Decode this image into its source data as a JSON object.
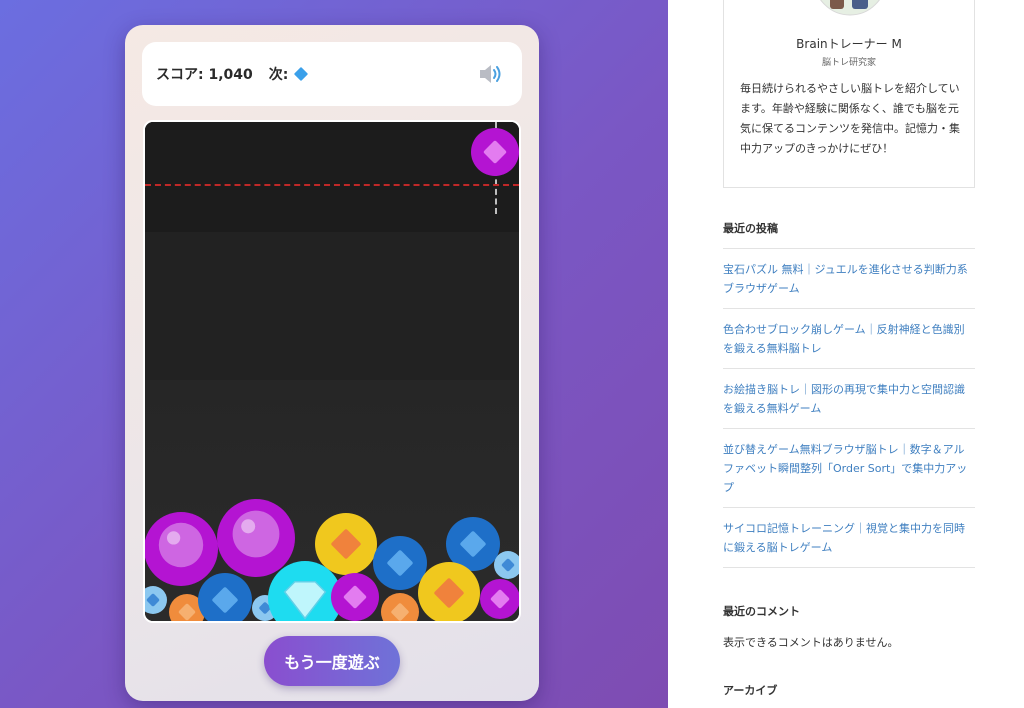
{
  "game": {
    "score_label": "スコア: 1,040",
    "next_label": "次:",
    "replay_label": "もう一度遊ぶ",
    "colors": {
      "purple": "#b414d2",
      "blue": "#1e6fc8",
      "yellow": "#f0c81e",
      "cyan": "#1edcf0",
      "orange": "#f08c3c",
      "lightblue": "#8cc8f0",
      "danger": "#c02828"
    }
  },
  "sidebar": {
    "profile": {
      "name": "Brainトレーナー M",
      "role": "脳トレ研究家",
      "description": "毎日続けられるやさしい脳トレを紹介しています。年齢や経験に関係なく、誰でも脳を元気に保てるコンテンツを発信中。記憶力・集中力アップのきっかけにぜひ！"
    },
    "recent_posts_title": "最近の投稿",
    "recent_posts": [
      "宝石パズル 無料｜ジュエルを進化させる判断力系ブラウザゲーム",
      "色合わせブロック崩しゲーム｜反射神経と色識別を鍛える無料脳トレ",
      "お絵描き脳トレ｜図形の再現で集中力と空間認識を鍛える無料ゲーム",
      "並び替えゲーム無料ブラウザ脳トレ｜数字＆アルファベット瞬間整列「Order Sort」で集中力アップ",
      "サイコロ記憶トレーニング｜視覚と集中力を同時に鍛える脳トレゲーム"
    ],
    "recent_comments_title": "最近のコメント",
    "recent_comments_empty": "表示できるコメントはありません。",
    "archive_title": "アーカイブ"
  }
}
